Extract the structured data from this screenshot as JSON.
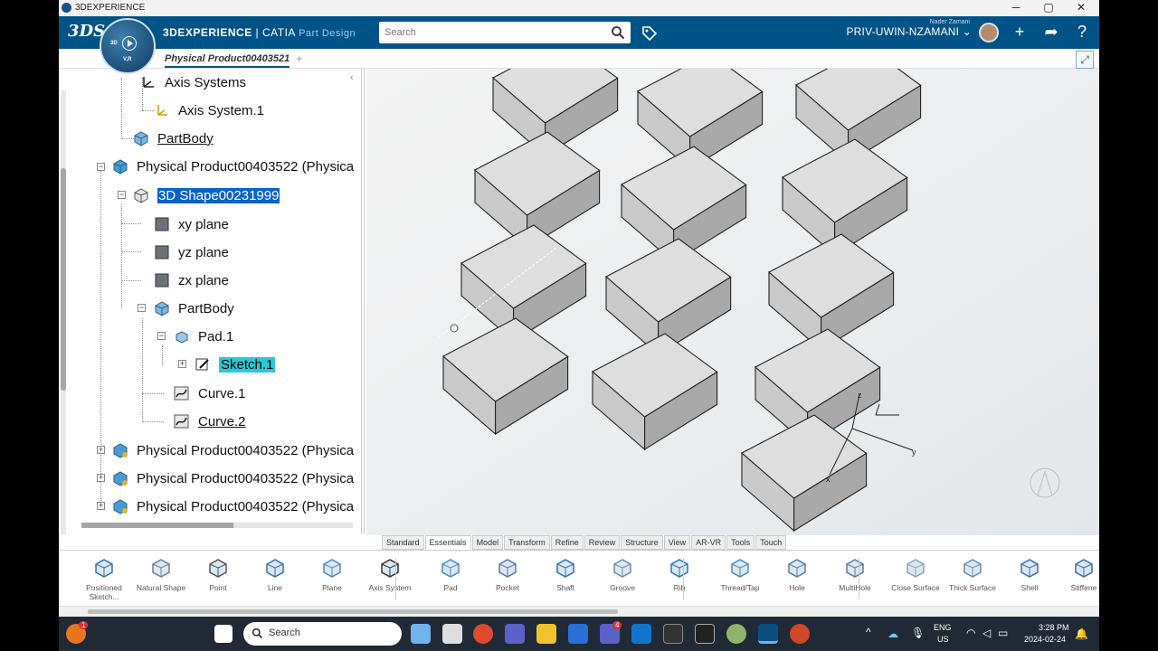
{
  "window": {
    "title": "3DEXPERIENCE",
    "controls": [
      "─",
      "▢",
      "✕"
    ]
  },
  "topbar": {
    "brand_main": "3DEXPERIENCE",
    "brand_sep": " | CATIA ",
    "brand_app": "Part Design",
    "search_placeholder": "Search",
    "user_name": "Nader Zamani",
    "workspace": "PRIV-UWIN-NZAMANI ⌄"
  },
  "compass": {
    "labels": [
      "3D",
      "V,R"
    ]
  },
  "doc_tab": {
    "label": "Physical Product00403521",
    "add": "+"
  },
  "tree": {
    "nodes": [
      {
        "label": "Axis Systems"
      },
      {
        "label": "Axis System.1"
      },
      {
        "label": "PartBody"
      },
      {
        "label": "Physical Product00403522 (Physica"
      },
      {
        "label": "3D Shape00231999"
      },
      {
        "label": "xy plane"
      },
      {
        "label": "yz plane"
      },
      {
        "label": "zx plane"
      },
      {
        "label": "PartBody"
      },
      {
        "label": "Pad.1"
      },
      {
        "label": "Sketch.1"
      },
      {
        "label": "Curve.1"
      },
      {
        "label": "Curve.2"
      },
      {
        "label": "Physical Product00403522 (Physica"
      },
      {
        "label": "Physical Product00403522 (Physica"
      },
      {
        "label": "Physical Product00403522 (Physica"
      }
    ]
  },
  "command_tabs": [
    "Standard",
    "Essentials",
    "Model",
    "Transform",
    "Refine",
    "Review",
    "Structure",
    "View",
    "AR-VR",
    "Tools",
    "Touch"
  ],
  "active_command_tab": "Essentials",
  "ribbon": [
    {
      "label": "Positioned Sketch..."
    },
    {
      "label": "Natural Shape"
    },
    {
      "label": "Point"
    },
    {
      "label": "Line"
    },
    {
      "label": "Plane"
    },
    {
      "label": "Axis System"
    },
    {
      "label": "Pad"
    },
    {
      "label": "Pocket"
    },
    {
      "label": "Shaft"
    },
    {
      "label": "Groove"
    },
    {
      "label": "Rib"
    },
    {
      "label": "Thread/Tap"
    },
    {
      "label": "Hole"
    },
    {
      "label": "MultiHole"
    },
    {
      "label": "Close Surface"
    },
    {
      "label": "Thick Surface"
    },
    {
      "label": "Shell"
    },
    {
      "label": "Stiffene"
    }
  ],
  "axis_labels": {
    "z": "z",
    "y": "y",
    "x": "x"
  },
  "taskbar": {
    "search": "Search",
    "lang1": "ENG",
    "lang2": "US",
    "time": "3:28 PM",
    "date": "2024-02-24",
    "badge": "1",
    "teams_badge": "4"
  },
  "colors": {
    "topbar": "#005386",
    "selection": "#0a62c9",
    "highlight": "#28c9d6"
  }
}
